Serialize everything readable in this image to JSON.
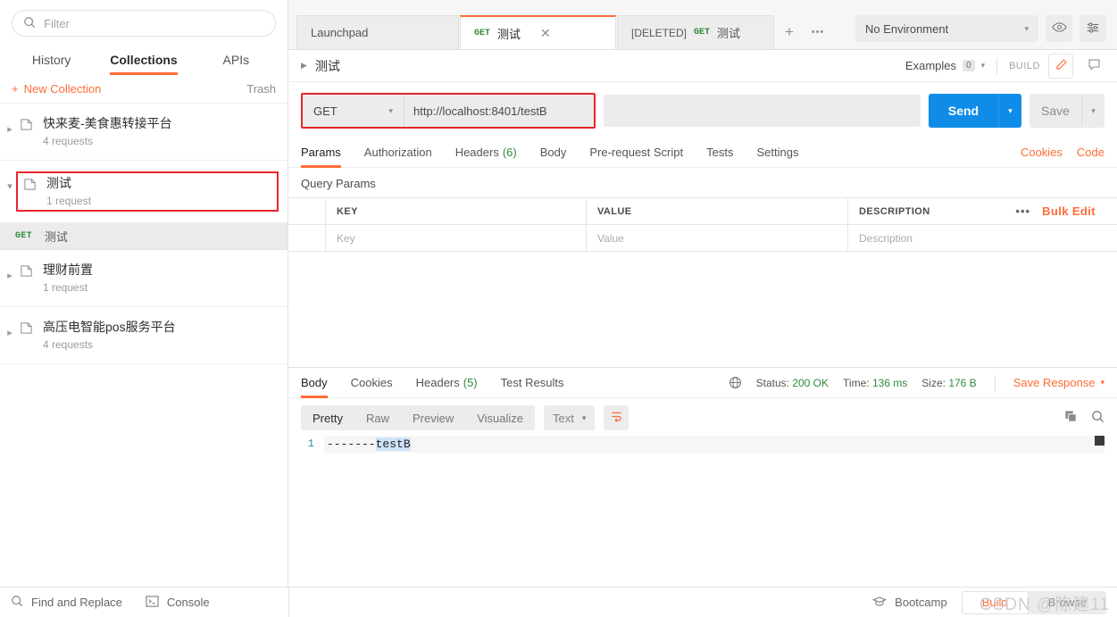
{
  "sidebar": {
    "filter_placeholder": "Filter",
    "tabs": [
      {
        "label": "History"
      },
      {
        "label": "Collections"
      },
      {
        "label": "APIs"
      }
    ],
    "new_collection": "New Collection",
    "trash": "Trash",
    "collections": [
      {
        "name": "快来麦-美食惠转接平台",
        "requests": "4 requests"
      },
      {
        "name": "测试",
        "requests": "1 request"
      },
      {
        "name": "理财前置",
        "requests": "1 request"
      },
      {
        "name": "高压电智能pos服务平台",
        "requests": "4 requests"
      }
    ],
    "child_request": {
      "method": "GET",
      "name": "测试"
    }
  },
  "tabbar": {
    "tabs": [
      {
        "label": "Launchpad",
        "method": "",
        "deleted": ""
      },
      {
        "label": "测试",
        "method": "GET",
        "deleted": ""
      },
      {
        "label": "测试",
        "method": "GET",
        "deleted": "[DELETED]"
      }
    ],
    "add": "+",
    "more": "•••"
  },
  "environment": {
    "selected": "No Environment",
    "chevron": "▾"
  },
  "breadcrumb": {
    "chevron": "▶",
    "name": "测试",
    "examples_label": "Examples",
    "examples_count": "0",
    "examples_chevron": "▾",
    "build_label": "BUILD"
  },
  "request": {
    "method": "GET",
    "method_chevron": "▾",
    "url": "http://localhost:8401/testB",
    "send_label": "Send",
    "send_chevron": "▾",
    "save_label": "Save",
    "save_chevron": "▾",
    "tabs": [
      {
        "label": "Params",
        "count": ""
      },
      {
        "label": "Authorization",
        "count": ""
      },
      {
        "label": "Headers",
        "count": "(6)"
      },
      {
        "label": "Body",
        "count": ""
      },
      {
        "label": "Pre-request Script",
        "count": ""
      },
      {
        "label": "Tests",
        "count": ""
      },
      {
        "label": "Settings",
        "count": ""
      }
    ],
    "cookies_link": "Cookies",
    "code_link": "Code"
  },
  "params": {
    "section_label": "Query Params",
    "columns": [
      "KEY",
      "VALUE",
      "DESCRIPTION"
    ],
    "placeholder_row": [
      "Key",
      "Value",
      "Description"
    ],
    "more_dots": "•••",
    "bulk_edit": "Bulk Edit"
  },
  "response": {
    "tabs": [
      {
        "label": "Body",
        "count": ""
      },
      {
        "label": "Cookies",
        "count": ""
      },
      {
        "label": "Headers",
        "count": "(5)"
      },
      {
        "label": "Test Results",
        "count": ""
      }
    ],
    "status_label": "Status:",
    "status_value": "200 OK",
    "time_label": "Time:",
    "time_value": "136 ms",
    "size_label": "Size:",
    "size_value": "176 B",
    "save_response": "Save Response",
    "save_response_chevron": "▾",
    "view_modes": [
      {
        "label": "Pretty"
      },
      {
        "label": "Raw"
      },
      {
        "label": "Preview"
      },
      {
        "label": "Visualize"
      }
    ],
    "format": "Text",
    "format_chevron": "▾",
    "line_number": "1",
    "body_prefix": "-------",
    "body_selected": "testB"
  },
  "statusbar": {
    "find_replace": "Find and Replace",
    "console": "Console",
    "bootcamp": "Bootcamp",
    "build": "Build",
    "browse": "Browse",
    "watermark": "CSDN @陈建11"
  },
  "colors": {
    "accent": "#ff6c37",
    "send_blue": "#0f8ce8",
    "method_green": "#2f8a3e",
    "annotation_red": "#e8262b"
  }
}
